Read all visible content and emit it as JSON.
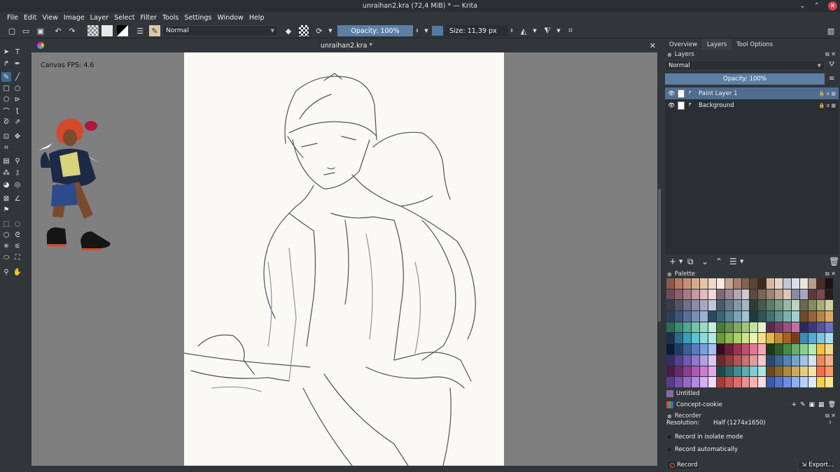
{
  "window": {
    "title": "unraihan2.kra (72,4 MiB) * — Krita"
  },
  "menu": [
    "File",
    "Edit",
    "View",
    "Image",
    "Layer",
    "Select",
    "Filter",
    "Tools",
    "Settings",
    "Window",
    "Help"
  ],
  "toolbar": {
    "blend_mode": "Normal",
    "opacity_label": "Opacity: 100%",
    "size_label": "Size: 11,39 px",
    "brush_color": "#4e7ca6"
  },
  "document": {
    "tab_title": "unraihan2.kra *",
    "fps_label": "Canvas FPS: 4.6"
  },
  "dockers": {
    "tabs": [
      "Overview",
      "Layers",
      "Tool Options"
    ],
    "active_tab": "Layers",
    "layers": {
      "header": "Layers",
      "blend_mode": "Normal",
      "opacity_label": "Opacity:  100%",
      "items": [
        {
          "name": "Paint Layer 1",
          "selected": true
        },
        {
          "name": "Background",
          "selected": false
        }
      ]
    },
    "palette": {
      "header": "Palette",
      "swatch_name": "Untitled",
      "palette_name": "Concept-cookie"
    },
    "recorder": {
      "header": "Recorder",
      "resolution_label": "Resolution:",
      "resolution_value": "Half (1274x1650)",
      "isolate_label": "Record in isolate mode",
      "auto_label": "Record automatically",
      "record_button": "Record",
      "export_button": "Export..."
    }
  }
}
